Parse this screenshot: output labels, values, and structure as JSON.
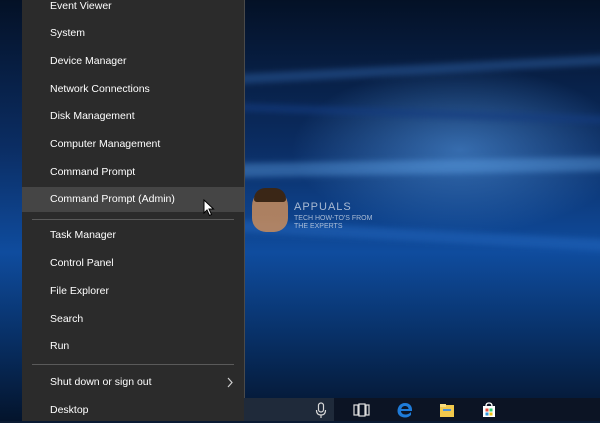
{
  "menu": {
    "items": [
      {
        "label": "Event Viewer"
      },
      {
        "label": "System"
      },
      {
        "label": "Device Manager"
      },
      {
        "label": "Network Connections"
      },
      {
        "label": "Disk Management"
      },
      {
        "label": "Computer Management"
      },
      {
        "label": "Command Prompt"
      },
      {
        "label": "Command Prompt (Admin)"
      },
      {
        "label": "Task Manager"
      },
      {
        "label": "Control Panel"
      },
      {
        "label": "File Explorer"
      },
      {
        "label": "Search"
      },
      {
        "label": "Run"
      },
      {
        "label": "Shut down or sign out"
      },
      {
        "label": "Desktop"
      }
    ],
    "hovered_item": "Command Prompt (Admin)"
  },
  "watermark": {
    "brand": "APPUALS",
    "line1": "TECH HOW-TO'S FROM",
    "line2": "THE EXPERTS"
  },
  "taskbar": {
    "icons": [
      "microphone-icon",
      "task-view-icon",
      "edge-icon",
      "file-explorer-icon",
      "store-icon"
    ]
  },
  "colors": {
    "menu_bg": "#2b2b2b",
    "hover_bg": "#454545",
    "text": "#ffffff",
    "edge_blue": "#1e7bd8"
  }
}
